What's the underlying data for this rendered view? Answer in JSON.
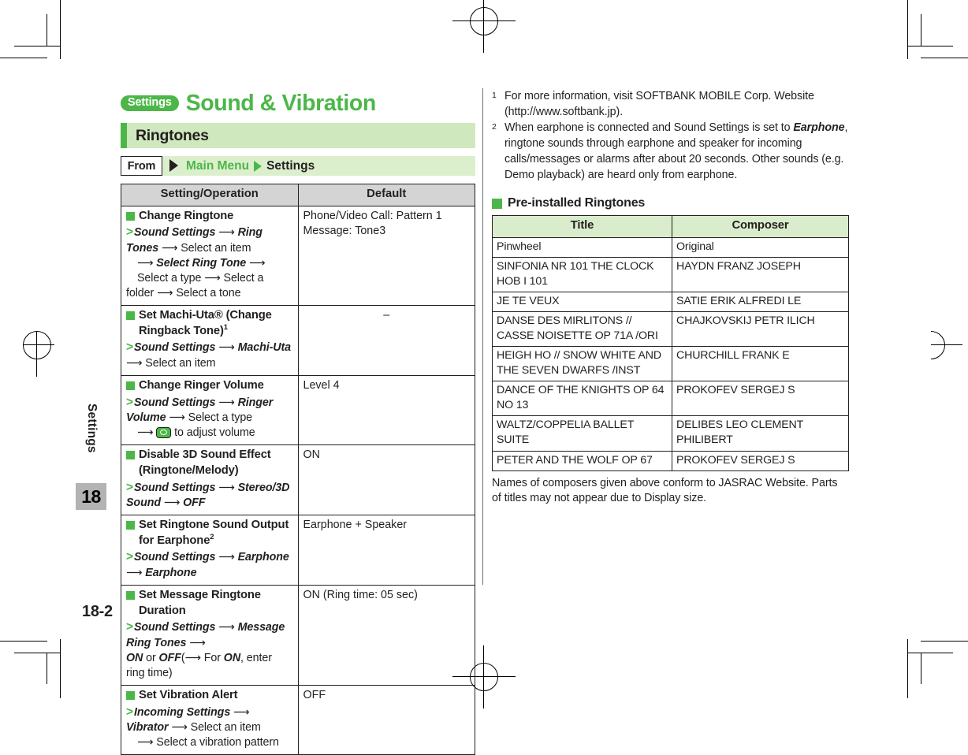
{
  "chapter_tab": {
    "label": "Settings",
    "number": "18"
  },
  "folio": "18-2",
  "header": {
    "pill": "Settings",
    "title": "Sound & Vibration",
    "band": "Ringtones",
    "from_badge": "From",
    "from_path_1": "Main Menu",
    "from_path_2": "Settings"
  },
  "settings_table": {
    "columns": [
      "Setting/Operation",
      "Default"
    ],
    "rows": [
      {
        "title": "Change Ringtone",
        "title_sup": "",
        "steps_line1_a": "Sound Settings",
        "steps_line1_b": "Ring Tones",
        "steps_line1_c": "Select an item",
        "steps_line2_a": "Select Ring Tone",
        "steps_line2_b": "Select a type",
        "steps_line2_c": "Select a",
        "steps_line3": "folder",
        "steps_line3_b": "Select a tone",
        "default": "Phone/Video Call: Pattern 1 Message: Tone3"
      },
      {
        "title": "Set Machi-Uta® (Change Ringback Tone)",
        "title_sup": "1",
        "steps_a": "Sound Settings",
        "steps_b": "Machi-Uta",
        "steps_c": "Select an item",
        "default": "–"
      },
      {
        "title": "Change Ringer Volume",
        "title_sup": "",
        "steps_a": "Sound Settings",
        "steps_b": "Ringer Volume",
        "steps_c": "Select a type",
        "steps_d": "to adjust volume",
        "default": "Level 4"
      },
      {
        "title": "Disable 3D Sound Effect (Ringtone/Melody)",
        "title_sup": "",
        "steps_a": "Sound Settings",
        "steps_b": "Stereo/3D Sound",
        "steps_c": "OFF",
        "default": "ON"
      },
      {
        "title": "Set Ringtone Sound Output for Earphone",
        "title_sup": "2",
        "steps_a": "Sound Settings",
        "steps_b": "Earphone",
        "steps_c": "Earphone",
        "default": "Earphone + Speaker"
      },
      {
        "title": "Set Message Ringtone Duration",
        "title_sup": "",
        "steps_a": "Sound Settings",
        "steps_b": "Message Ring Tones",
        "steps_c": "ON",
        "steps_d": "or",
        "steps_e": "OFF",
        "steps_f": "For",
        "steps_g": "ON",
        "steps_h": ", enter ring time)",
        "default": "ON (Ring time: 05 sec)"
      },
      {
        "title": "Set Vibration Alert",
        "title_sup": "",
        "steps_a": "Incoming Settings",
        "steps_b": "Vibrator",
        "steps_c": "Select an item",
        "steps_d": "Select a vibration pattern",
        "default": "OFF"
      }
    ]
  },
  "footnotes": [
    {
      "num": "1",
      "text": "For more information, visit SOFTBANK MOBILE Corp. Website (http://www.softbank.jp)."
    },
    {
      "num": "2",
      "text_before": "When earphone is connected and Sound Settings is set to ",
      "emphasis": "Earphone",
      "text_after": ", ringtone sounds through earphone and speaker for incoming calls/messages or alarms after about 20 seconds. Other sounds (e.g. Demo playback) are heard only from earphone."
    }
  ],
  "ringtones_section": {
    "heading": "Pre-installed Ringtones",
    "columns": [
      "Title",
      "Composer"
    ],
    "rows": [
      {
        "title": "Pinwheel",
        "composer": "Original"
      },
      {
        "title": "SINFONIA NR 101 THE CLOCK HOB I 101",
        "composer": "HAYDN FRANZ JOSEPH"
      },
      {
        "title": "JE TE VEUX",
        "composer": "SATIE ERIK ALFREDI LE"
      },
      {
        "title": "DANSE DES MIRLITONS // CASSE NOISETTE OP 71A /ORI",
        "composer": "CHAJKOVSKIJ PETR ILICH"
      },
      {
        "title": "HEIGH HO // SNOW WHITE AND THE SEVEN DWARFS /INST",
        "composer": "CHURCHILL FRANK E"
      },
      {
        "title": "DANCE OF THE KNIGHTS OP 64 NO 13",
        "composer": "PROKOFEV SERGEJ S"
      },
      {
        "title": "WALTZ/COPPELIA BALLET SUITE",
        "composer": "DELIBES LEO CLEMENT PHILIBERT"
      },
      {
        "title": "PETER AND THE WOLF OP 67",
        "composer": "PROKOFEV SERGEJ S"
      }
    ],
    "note": "Names of composers given above conform to JASRAC Website. Parts of titles may not appear due to Display size."
  },
  "colors": {
    "accent_green": "#4CB748",
    "band_green": "#cfe8bd",
    "from_green": "#dcefcd",
    "table_header_gray": "#d4d4d4",
    "tone_header_green": "#d9eccb",
    "tab_gray": "#b3b3b3"
  }
}
